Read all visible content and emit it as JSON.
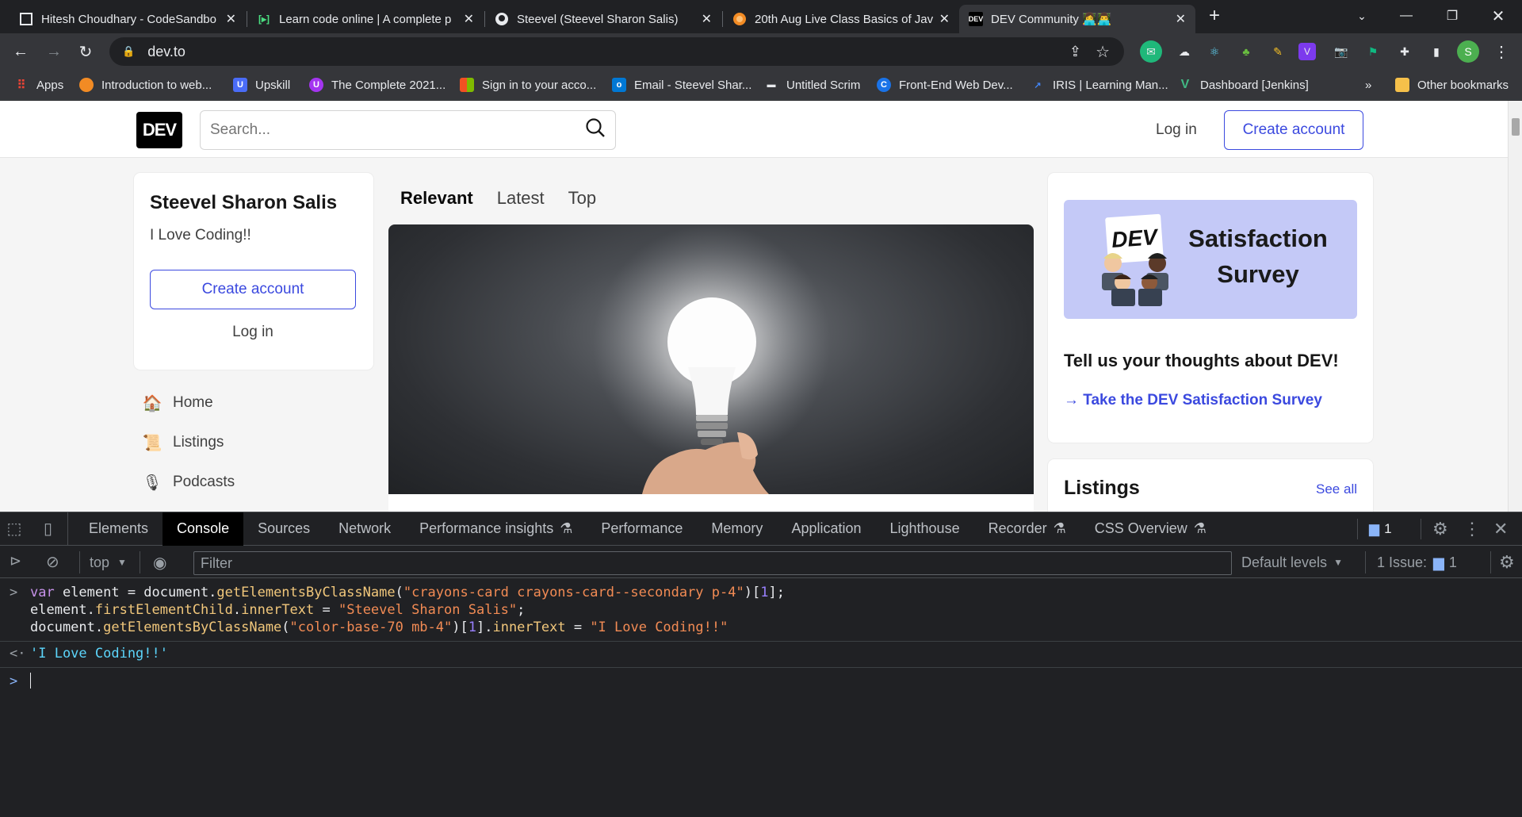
{
  "browser": {
    "tabs": [
      {
        "title": "Hitesh Choudhary - CodeSandbo",
        "icon": "codesandbox-icon"
      },
      {
        "title": "Learn code online | A complete p",
        "icon": "scrimba-icon"
      },
      {
        "title": "Steevel (Steevel Sharon Salis)",
        "icon": "github-icon"
      },
      {
        "title": "20th Aug Live Class Basics of Java",
        "icon": "course-icon"
      },
      {
        "title": "DEV Community 👩‍💻👨‍💻",
        "icon": "dev-icon"
      }
    ],
    "address": "dev.to",
    "profile_initial": "S",
    "bookmarks": [
      {
        "label": "Apps",
        "icon": "apps-grid-icon",
        "color": "#e8eaed"
      },
      {
        "label": "Introduction to web...",
        "icon": "circle-icon",
        "color": "#f28b24"
      },
      {
        "label": "Upskill",
        "icon": "u-icon",
        "color": "#4a6cf7"
      },
      {
        "label": "The Complete 2021...",
        "icon": "udemy-icon",
        "color": "#a435f0"
      },
      {
        "label": "Sign in to your acco...",
        "icon": "microsoft-icon",
        "color": "#f25022"
      },
      {
        "label": "Email - Steevel Shar...",
        "icon": "outlook-icon",
        "color": "#0078d4"
      },
      {
        "label": "Untitled Scrim",
        "icon": "scrim-icon",
        "color": "#e8eaed"
      },
      {
        "label": "Front-End Web Dev...",
        "icon": "c-icon",
        "color": "#1a73e8"
      },
      {
        "label": "IRIS | Learning Man...",
        "icon": "iris-icon",
        "color": "#4285f4"
      },
      {
        "label": "Dashboard [Jenkins]",
        "icon": "v-icon",
        "color": "#41b883"
      }
    ],
    "bookmarks_overflow": "»",
    "other_bookmarks": "Other bookmarks"
  },
  "dev": {
    "logo": "DEV",
    "search_placeholder": "Search...",
    "login": "Log in",
    "create_account": "Create account",
    "sidebar_card": {
      "name": "Steevel Sharon Salis",
      "tagline": "I Love Coding!!",
      "create_account": "Create account",
      "login": "Log in"
    },
    "nav": [
      {
        "label": "Home",
        "icon": "house-icon",
        "glyph": "🏠"
      },
      {
        "label": "Listings",
        "icon": "scroll-icon",
        "glyph": "📜"
      },
      {
        "label": "Podcasts",
        "icon": "microphone-icon",
        "glyph": "🎙"
      }
    ],
    "feed_tabs": [
      "Relevant",
      "Latest",
      "Top"
    ],
    "survey": {
      "banner_logo": "DEV",
      "banner_title_1": "Satisfaction",
      "banner_title_2": "Survey",
      "heading": "Tell us your thoughts about DEV!",
      "link": "→ Take the DEV Satisfaction Survey"
    },
    "listings": {
      "title": "Listings",
      "see_all": "See all"
    }
  },
  "devtools": {
    "tabs": [
      "Elements",
      "Console",
      "Sources",
      "Network",
      "Performance insights",
      "Performance",
      "Memory",
      "Application",
      "Lighthouse",
      "Recorder",
      "CSS Overview"
    ],
    "active_tab": "Console",
    "message_count": "1",
    "context": "top",
    "filter_placeholder": "Filter",
    "levels": "Default levels",
    "issues_label": "1 Issue:",
    "issues_count": "1",
    "console_lines": [
      "var element = document.getElementsByClassName(\"crayons-card crayons-card--secondary p-4\")[1];",
      "element.firstElementChild.innerText = \"Steevel Sharon Salis\";",
      "document.getElementsByClassName(\"color-base-70 mb-4\")[1].innerText = \"I Love Coding!!\""
    ],
    "result": "'I Love Coding!!'"
  }
}
